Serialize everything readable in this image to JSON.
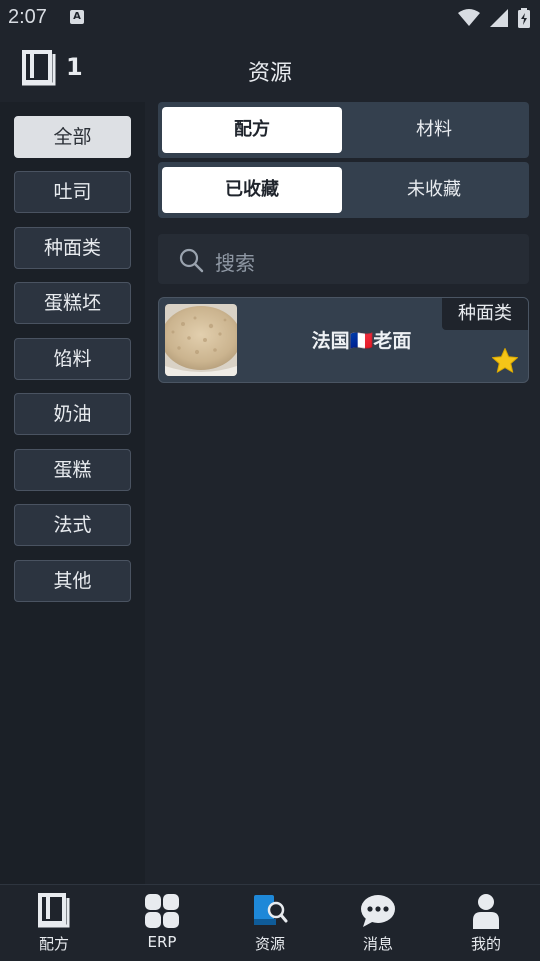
{
  "status_bar": {
    "time": "2:07"
  },
  "header": {
    "count": "1",
    "title": "资源"
  },
  "sidebar": {
    "categories": [
      {
        "label": "全部",
        "active": true
      },
      {
        "label": "吐司"
      },
      {
        "label": "种面类"
      },
      {
        "label": "蛋糕坯"
      },
      {
        "label": "馅料"
      },
      {
        "label": "奶油"
      },
      {
        "label": "蛋糕"
      },
      {
        "label": "法式"
      },
      {
        "label": "其他"
      }
    ]
  },
  "main": {
    "type_tabs": {
      "left": "配方",
      "right": "材料",
      "selected": "配方"
    },
    "fav_tabs": {
      "left": "已收藏",
      "right": "未收藏",
      "selected": "已收藏"
    },
    "search": {
      "placeholder": "搜索"
    },
    "items": [
      {
        "name": "法国🇫🇷老面",
        "category": "种面类",
        "favorited": true
      }
    ]
  },
  "bottom_nav": {
    "tabs": [
      {
        "label": "配方",
        "icon": "book-icon"
      },
      {
        "label": "ERP",
        "icon": "grid-icon"
      },
      {
        "label": "资源",
        "icon": "book-search-icon",
        "active": true
      },
      {
        "label": "消息",
        "icon": "chat-bubble-icon"
      },
      {
        "label": "我的",
        "icon": "user-icon"
      }
    ]
  },
  "colors": {
    "background": "#1f242c",
    "sidebar": "#1b2027",
    "segment": "#34404e",
    "accent_blue": "#1e88d8",
    "star": "#f5c518"
  }
}
